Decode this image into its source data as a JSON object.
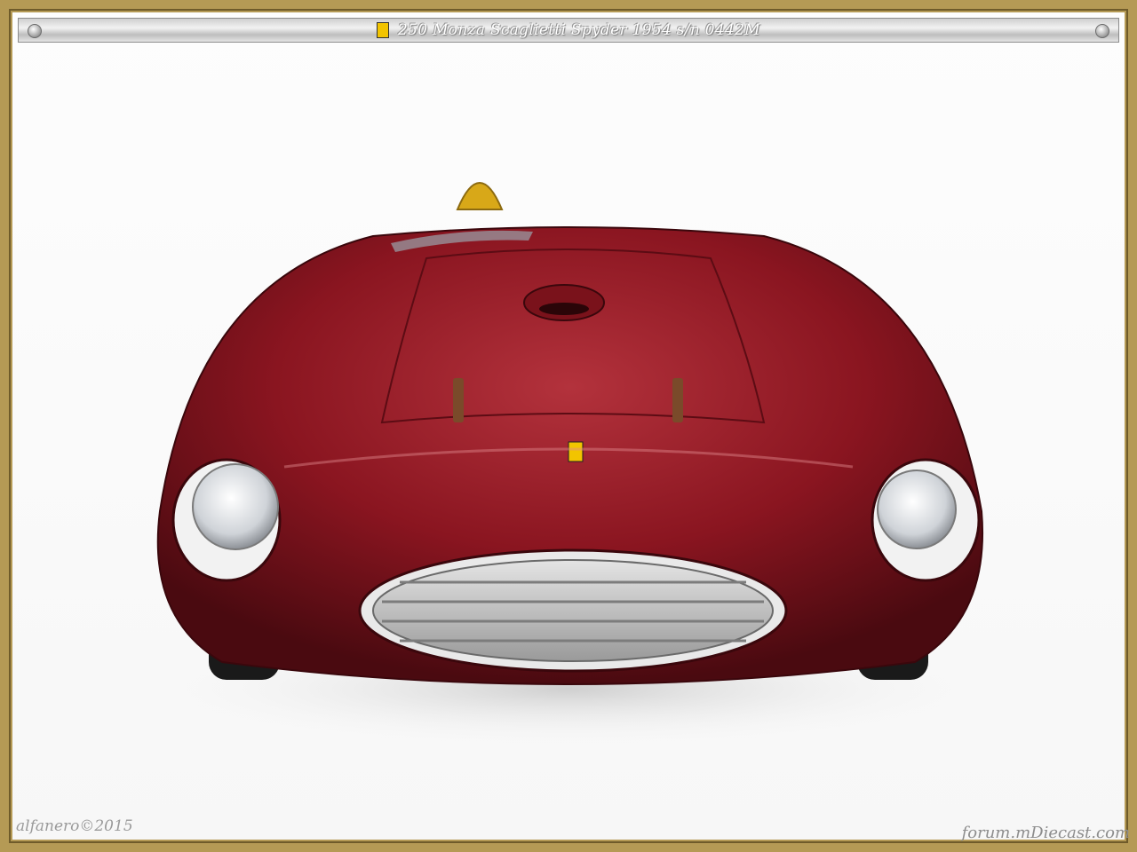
{
  "header": {
    "title": "250 Monza Scaglietti Spyder 1954  s/n 0442M",
    "logo_icon": "prancing-horse-shield-icon"
  },
  "watermarks": {
    "left": "alfanero©2015",
    "right": "forum.mDiecast.com"
  },
  "colors": {
    "frame_gold": "#b59a55",
    "car_body": "#8a1520",
    "headlight_rim": "#f2f2f2",
    "seat_yellow": "#d8a818"
  }
}
